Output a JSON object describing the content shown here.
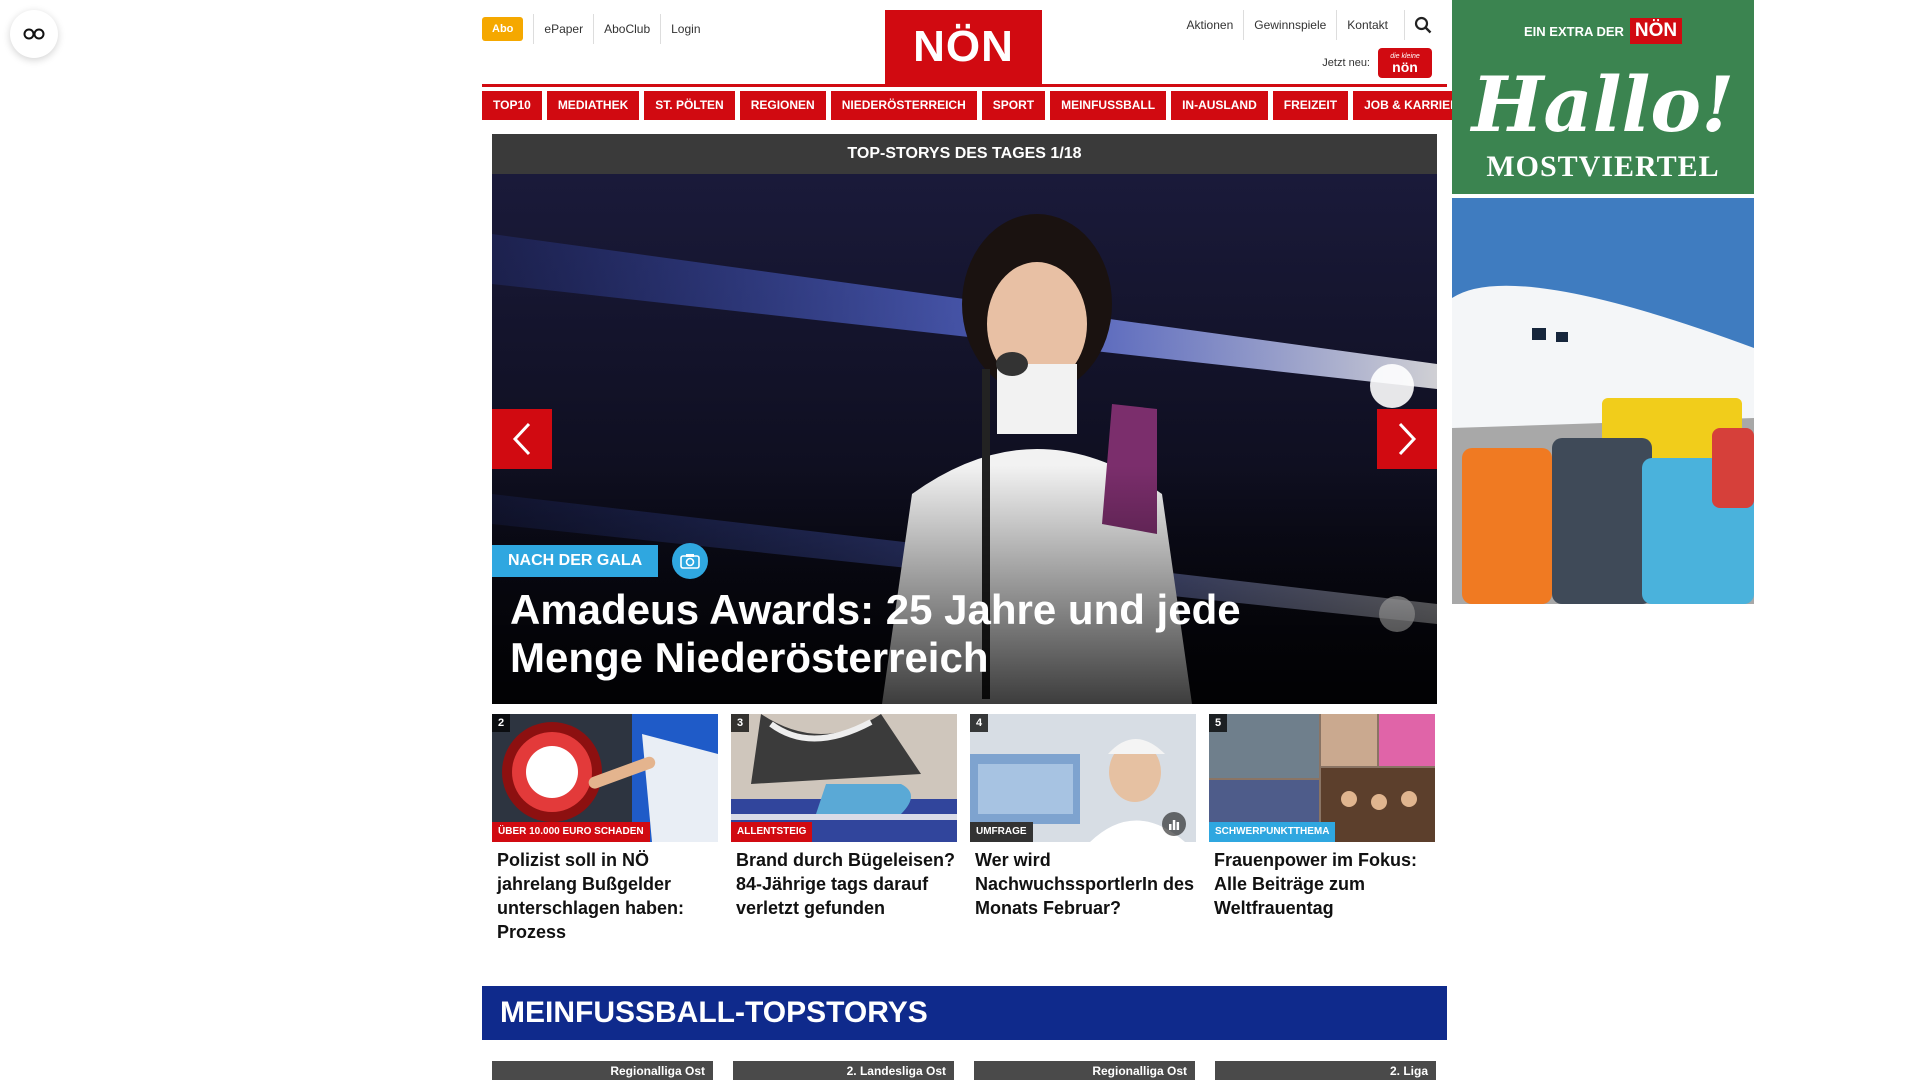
{
  "header": {
    "abo_label": "Abo",
    "left_links": [
      "ePaper",
      "AboClub",
      "Login"
    ],
    "logo_text": "NÖN",
    "right_links": [
      "Aktionen",
      "Gewinnspiele",
      "Kontakt"
    ],
    "jetzt_label": "Jetzt neu:",
    "jetzt_badge_top": "die kleine",
    "jetzt_badge_text": "nön"
  },
  "nav": {
    "items": [
      "TOP10",
      "MEDIATHEK",
      "ST. PÖLTEN",
      "REGIONEN",
      "NIEDERÖSTERREICH",
      "SPORT",
      "MEINFUSSBALL",
      "IN-AUSLAND",
      "FREIZEIT",
      "JOB & KARRIERE"
    ]
  },
  "hero": {
    "bar_title": "TOP-STORYS DES TAGES 1/18",
    "kicker": "NACH DER GALA",
    "title": "Amadeus Awards: 25 Jahre und jede Menge Niederösterreich",
    "prev_icon": "chevron-left-icon",
    "next_icon": "chevron-right-icon",
    "media_icon": "camera-icon"
  },
  "teasers": [
    {
      "number": "2",
      "kicker": "ÜBER 10.000 EURO SCHADEN",
      "kicker_color": "#d10a11",
      "title": "Polizist soll in NÖ jahrelang Bußgelder unterschlagen haben: Prozess"
    },
    {
      "number": "3",
      "kicker": "ALLENTSTEIG",
      "kicker_color": "#d10a11",
      "title": "Brand durch Bügeleisen? 84-Jährige tags darauf verletzt gefunden"
    },
    {
      "number": "4",
      "kicker": "UMFRAGE",
      "kicker_color": "#333333",
      "title": "Wer wird NachwuchssportlerIn des Monats Februar?",
      "badge_icon": "bar-chart-icon"
    },
    {
      "number": "5",
      "kicker": "SCHWERPUNKTTHEMA",
      "kicker_color": "#2fa7e0",
      "title": "Frauenpower im Fokus: Alle Beiträge zum Weltfrauentag"
    }
  ],
  "meinfussball": {
    "title": "MEINFUSSBALL-TOPSTORYS",
    "cards": [
      {
        "league": "Regionalliga Ost"
      },
      {
        "league": "2. Landesliga Ost"
      },
      {
        "league": "Regionalliga Ost"
      },
      {
        "league": "2. Liga"
      }
    ]
  },
  "ad": {
    "extra_text": "EIN EXTRA DER",
    "brand": "NÖN",
    "headline": "Hallo!",
    "region": "MOSTVIERTEL"
  },
  "colors": {
    "brand_red": "#d10a11",
    "accent_blue": "#2fa7e0",
    "abo_orange": "#f5a800",
    "meinfussball_blue": "#0f2a8c",
    "ad_green": "#3b8450"
  }
}
